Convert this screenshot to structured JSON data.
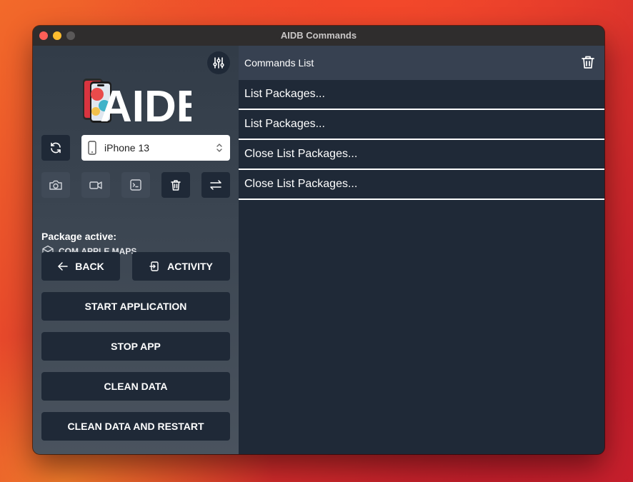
{
  "window": {
    "title": "AIDB Commands"
  },
  "sidebar": {
    "logo_text": "AIDB",
    "device": {
      "selected": "iPhone 13"
    },
    "package": {
      "label": "Package active:",
      "name": "COM.APPLE.MAPS"
    },
    "buttons": {
      "back": "BACK",
      "activity": "ACTIVITY",
      "start_application": "START APPLICATION",
      "stop_app": "STOP APP",
      "clean_data": "CLEAN DATA",
      "clean_data_restart": "CLEAN DATA AND RESTART"
    }
  },
  "commands": {
    "header": "Commands List",
    "items": [
      "List Packages...",
      "List Packages...",
      "Close List Packages...",
      "Close List Packages..."
    ]
  },
  "colors": {
    "panel_dark": "#1f2937",
    "header": "#374151",
    "close": "#ff5f57",
    "minimize": "#febc2e"
  }
}
